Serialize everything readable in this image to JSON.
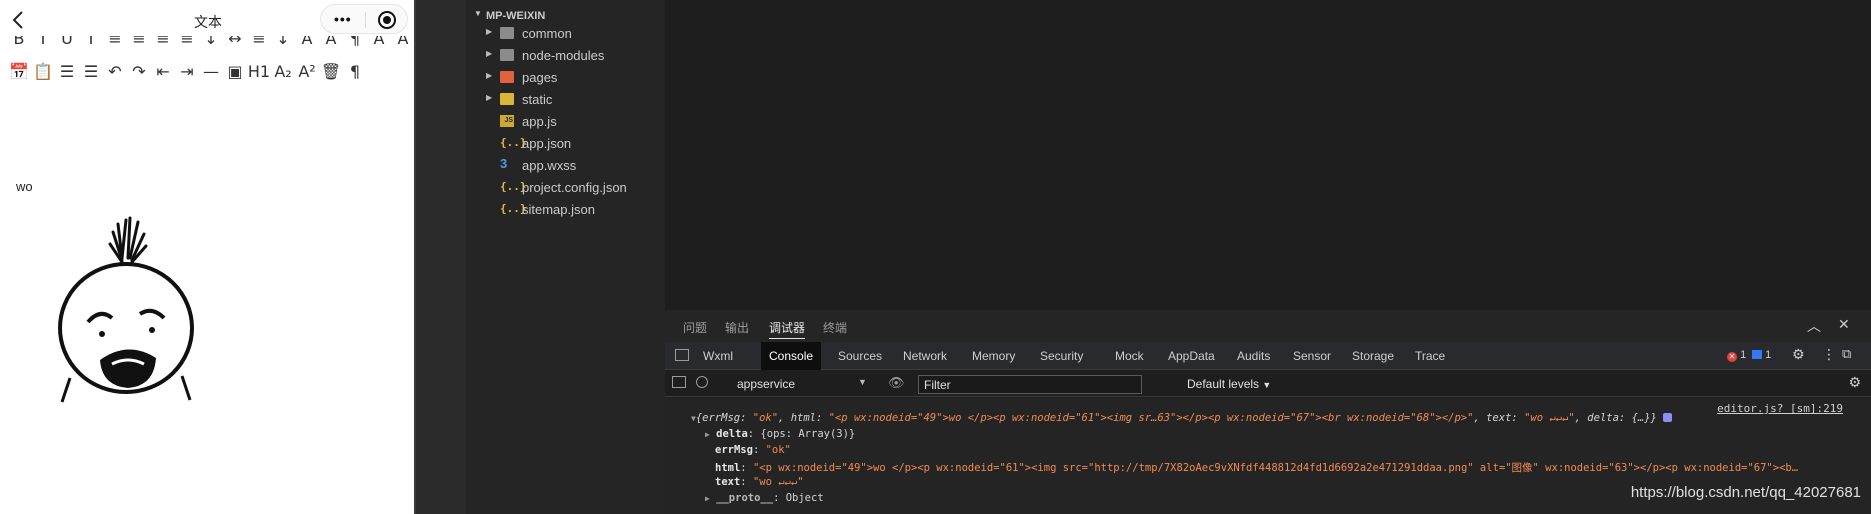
{
  "simulator": {
    "title": "文本",
    "capsule_more": "•••",
    "editor_text": "wo",
    "toolbar_row2": [
      {
        "icon": "date-icon",
        "glyph": "📅"
      },
      {
        "icon": "clipboard-icon",
        "glyph": "📋"
      },
      {
        "icon": "ordered-list-icon",
        "glyph": "☰"
      },
      {
        "icon": "bullet-list-icon",
        "glyph": "☰"
      },
      {
        "icon": "undo-icon",
        "glyph": "↶"
      },
      {
        "icon": "redo-icon",
        "glyph": "↷"
      },
      {
        "icon": "outdent-icon",
        "glyph": "⇤"
      },
      {
        "icon": "indent-icon",
        "glyph": "⇥"
      },
      {
        "icon": "horizontal-rule-icon",
        "glyph": "—"
      },
      {
        "icon": "image-icon",
        "glyph": "▣"
      },
      {
        "icon": "heading-icon",
        "glyph": "H1"
      },
      {
        "icon": "subscript-icon",
        "glyph": "A₂"
      },
      {
        "icon": "superscript-icon",
        "glyph": "A²"
      },
      {
        "icon": "delete-icon",
        "glyph": "🗑"
      },
      {
        "icon": "paragraph-icon",
        "glyph": "¶"
      }
    ],
    "toolbar_row1": [
      {
        "icon": "bold-icon",
        "glyph": "B"
      },
      {
        "icon": "italic-icon",
        "glyph": "I"
      },
      {
        "icon": "underline-icon",
        "glyph": "U"
      },
      {
        "icon": "strike-icon",
        "glyph": "I"
      },
      {
        "icon": "align-left-icon",
        "glyph": "≡"
      },
      {
        "icon": "align-center-icon",
        "glyph": "≡"
      },
      {
        "icon": "align-right-icon",
        "glyph": "≡"
      },
      {
        "icon": "align-justify-icon",
        "glyph": "≡"
      },
      {
        "icon": "line-height-icon",
        "glyph": "↕"
      },
      {
        "icon": "letter-spacing-icon",
        "glyph": "↔"
      },
      {
        "icon": "margin-top-icon",
        "glyph": "≡"
      },
      {
        "icon": "margin-bottom-icon",
        "glyph": "↓"
      },
      {
        "icon": "font-family-icon",
        "glyph": "A"
      },
      {
        "icon": "font-size-icon",
        "glyph": "A"
      },
      {
        "icon": "text-dir-icon",
        "glyph": "¶"
      },
      {
        "icon": "color-icon",
        "glyph": "A"
      },
      {
        "icon": "bg-color-icon",
        "glyph": "A"
      }
    ]
  },
  "explorer": {
    "root": "MP-WEIXIN",
    "items": [
      {
        "name": "common",
        "type": "folder",
        "color": "#8c8c8c",
        "expandable": true
      },
      {
        "name": "node-modules",
        "type": "folder",
        "color": "#8c8c8c",
        "expandable": true
      },
      {
        "name": "pages",
        "type": "folder",
        "color": "#e0623f",
        "expandable": true
      },
      {
        "name": "static",
        "type": "folder",
        "color": "#dcb436",
        "expandable": true
      },
      {
        "name": "app.js",
        "type": "js",
        "color": "#cfa92e",
        "expandable": false
      },
      {
        "name": "app.json",
        "type": "json",
        "color": "#e5b84a",
        "expandable": false
      },
      {
        "name": "app.wxss",
        "type": "wxss",
        "color": "#4a9be0",
        "expandable": false
      },
      {
        "name": "project.config.json",
        "type": "json",
        "color": "#e5b84a",
        "expandable": false
      },
      {
        "name": "sitemap.json",
        "type": "json",
        "color": "#e5b84a",
        "expandable": false
      }
    ]
  },
  "panel": {
    "tabs": [
      "问题",
      "输出",
      "调试器",
      "终端"
    ],
    "active_tab": "调试器"
  },
  "devtools": {
    "tabs": [
      "Wxml",
      "Console",
      "Sources",
      "Network",
      "Memory",
      "Security",
      "Mock",
      "AppData",
      "Audits",
      "Sensor",
      "Storage",
      "Trace"
    ],
    "active_tab": "Console",
    "error_count": "1",
    "message_count": "1",
    "context": "appservice",
    "filter_placeholder": "Filter",
    "levels": "Default levels"
  },
  "console": {
    "source_link": "editor.js? [sm]:219",
    "line1": {
      "open": "{",
      "errMsg_key": "errMsg",
      "errMsg_val": "\"ok\"",
      "html_key": "html",
      "html_val": "\"<p wx:nodeid=\"49\">wo </p><p wx:nodeid=\"61\"><img sr…63\"></p><p wx:nodeid=\"67\"><br wx:nodeid=\"68\"></p>\"",
      "text_key": "text",
      "text_val": "\"wo ↵↵↵\"",
      "delta_key": "delta",
      "delta_val": "{…}}"
    },
    "delta_line": {
      "key": "delta",
      "val": "{ops: Array(3)}"
    },
    "errmsg_line": {
      "key": "errMsg",
      "val": "\"ok\""
    },
    "html_line": {
      "key": "html",
      "val": "\"<p wx:nodeid=\"49\">wo </p><p wx:nodeid=\"61\"><img src=\"http://tmp/7X82oAec9vXNfdf448812d4fd1d6692a2e471291ddaa.png\" alt=\"图像\" wx:nodeid=\"63\"></p><p wx:nodeid=\"67\"><b…"
    },
    "text_line": {
      "key": "text",
      "val": "\"wo ↵↵↵\""
    },
    "proto_line": {
      "key": "__proto__",
      "val": "Object"
    }
  },
  "watermark": "https://blog.csdn.net/qq_42027681"
}
